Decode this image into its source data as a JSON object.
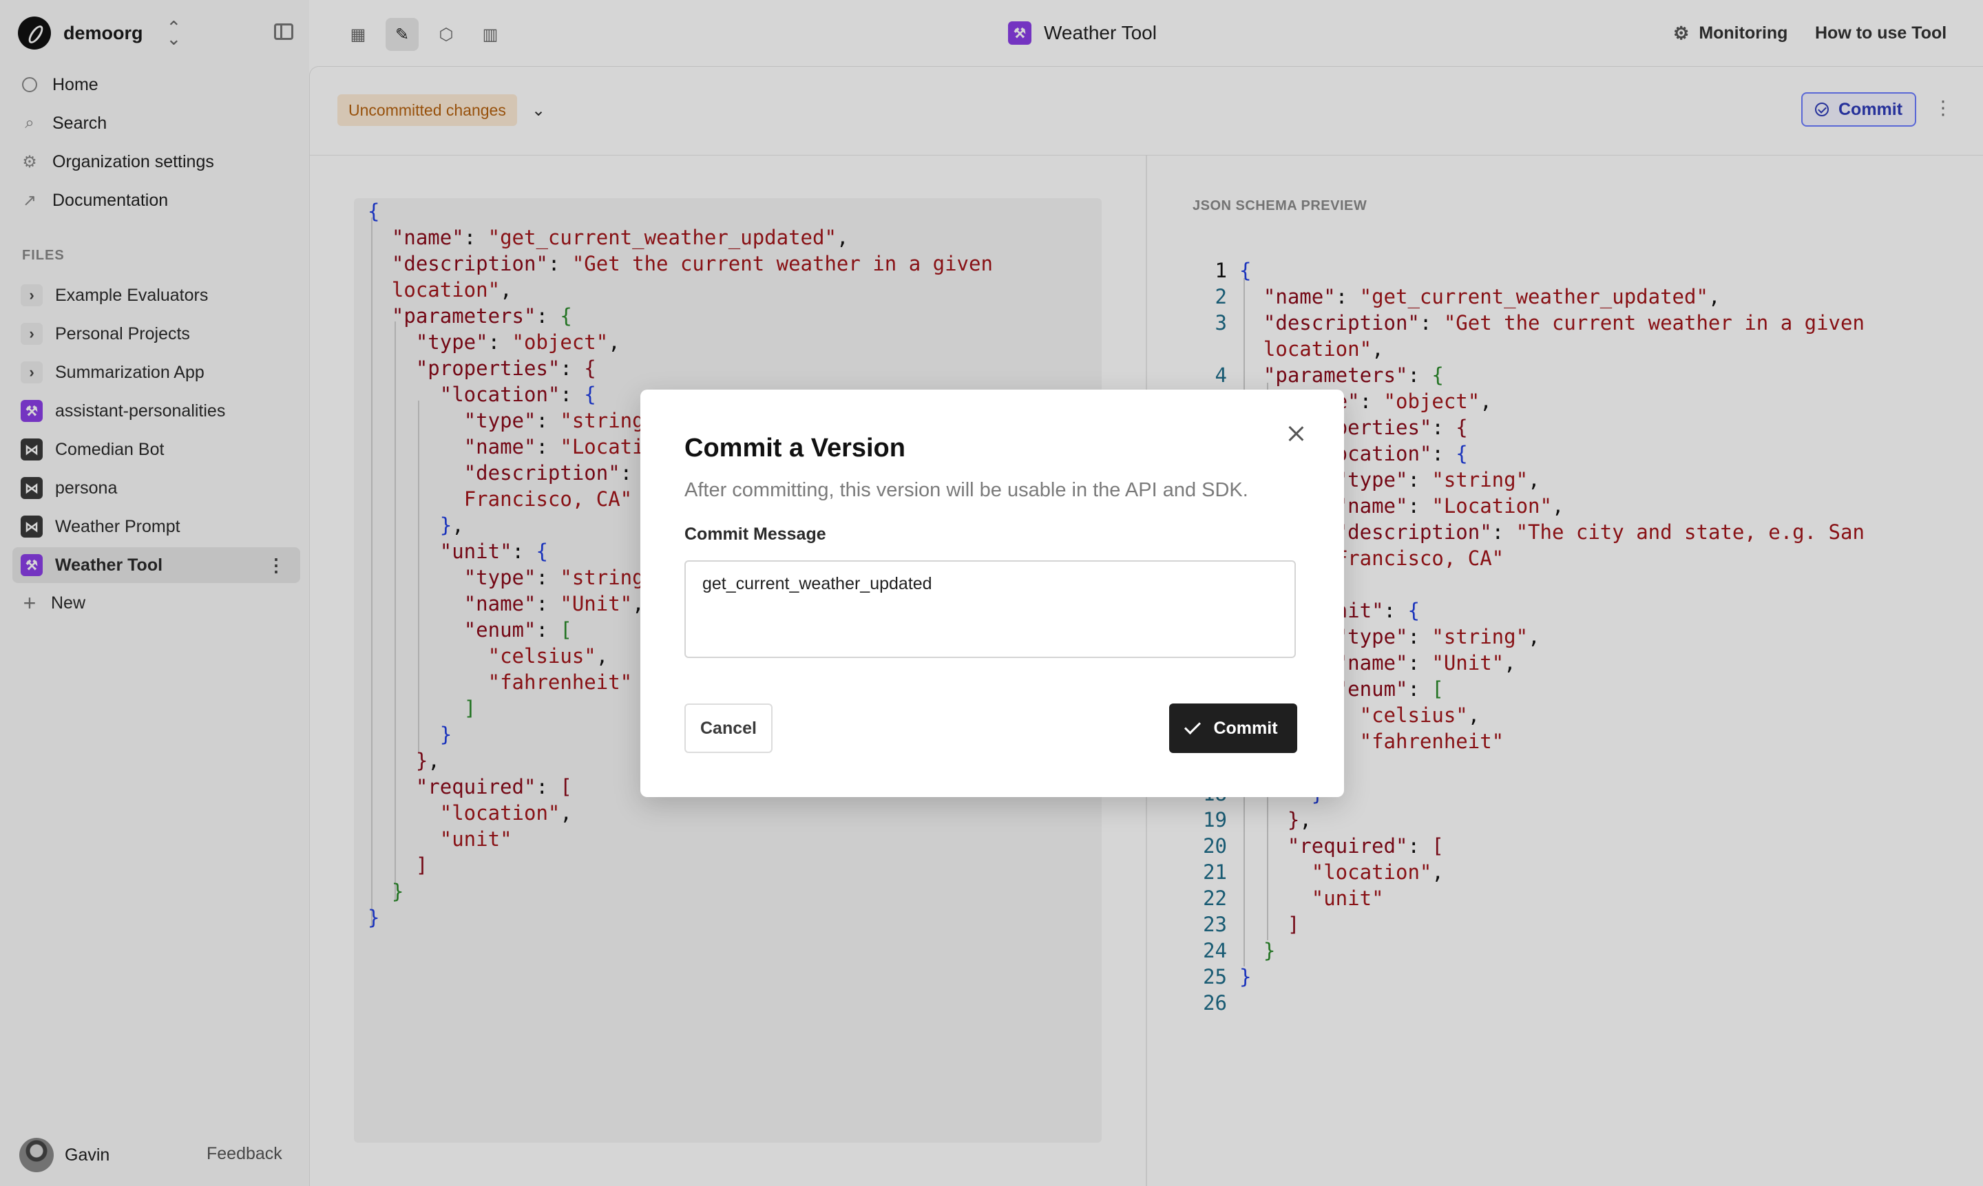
{
  "org": {
    "name": "demoorg"
  },
  "nav": {
    "home": "Home",
    "search": "Search",
    "org_settings": "Organization settings",
    "documentation": "Documentation"
  },
  "files": {
    "heading": "FILES",
    "items": [
      {
        "label": "Example Evaluators",
        "icon": "chevron-right-icon"
      },
      {
        "label": "Personal Projects",
        "icon": "chevron-right-icon"
      },
      {
        "label": "Summarization App",
        "icon": "chevron-right-icon"
      },
      {
        "label": "assistant-personalities",
        "icon": "tool-icon"
      },
      {
        "label": "Comedian Bot",
        "icon": "prompt-icon"
      },
      {
        "label": "persona",
        "icon": "prompt-icon"
      },
      {
        "label": "Weather Prompt",
        "icon": "prompt-icon"
      },
      {
        "label": "Weather Tool",
        "icon": "tool-icon",
        "selected": true
      }
    ],
    "new_label": "New"
  },
  "user": {
    "name": "Gavin",
    "feedback": "Feedback"
  },
  "topbar": {
    "title": "Weather Tool",
    "monitoring": "Monitoring",
    "how_to": "How to use Tool"
  },
  "toolbar": {
    "badge": "Uncommitted changes",
    "commit_label": "Commit"
  },
  "preview": {
    "heading": "JSON SCHEMA PREVIEW"
  },
  "modal": {
    "title": "Commit a Version",
    "subtitle": "After committing, this version will be usable in the API and SDK.",
    "field_label": "Commit Message",
    "field_value": "get_current_weather_updated",
    "cancel": "Cancel",
    "commit": "Commit"
  },
  "colors": {
    "tool_accent": "#8b3fe6",
    "badge_bg": "#fdebd6",
    "badge_text": "#b4610f",
    "commit_outline": "#6b7bff",
    "primary_button": "#1f1f1f"
  }
}
